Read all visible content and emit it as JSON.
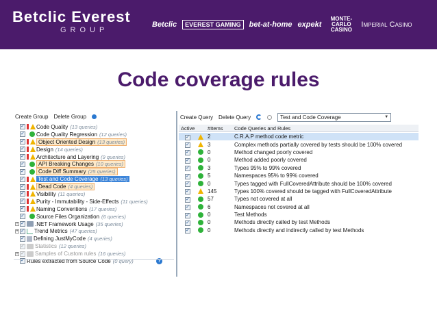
{
  "header": {
    "brand_name": "Betclic Everest",
    "brand_sub": "GROUP",
    "logos": [
      "Betclic",
      "EVEREST GAMING",
      "bet-at-home",
      "expekt",
      "MONTE-CARLO CASINO",
      "Imperial Casino"
    ]
  },
  "slide_title": "Code coverage rules",
  "left_toolbar": {
    "create_group": "Create Group",
    "delete_group": "Delete Group"
  },
  "tree": [
    {
      "label": "Code Quality",
      "count": "(13 queries)",
      "icon": "warning-icon",
      "expander": "",
      "hl": ""
    },
    {
      "label": "Code Quality Regression",
      "count": "(12 queries)",
      "icon": "ok-icon",
      "expander": "",
      "hl": ""
    },
    {
      "label": "Object Oriented Design",
      "count": "(13 queries)",
      "icon": "warning-icon",
      "expander": "",
      "hl": "orange"
    },
    {
      "label": "Design",
      "count": "(14 queries)",
      "icon": "warning-icon",
      "expander": "",
      "hl": ""
    },
    {
      "label": "Architecture and Layering",
      "count": "(9 queries)",
      "icon": "warning-icon",
      "expander": "",
      "hl": ""
    },
    {
      "label": "API Breaking Changes",
      "count": "(10 queries)",
      "icon": "ok-icon",
      "expander": "",
      "hl": "orange"
    },
    {
      "label": "Code Diff Summary",
      "count": "(25 queries)",
      "icon": "ok-icon",
      "expander": "",
      "hl": "orange"
    },
    {
      "label": "Test and Code Coverage",
      "count": "(13 queries)",
      "icon": "warning-icon",
      "expander": "",
      "hl": "blue"
    },
    {
      "label": "Dead Code",
      "count": "(4 queries)",
      "icon": "warning-icon",
      "expander": "",
      "hl": "orange"
    },
    {
      "label": "Visibility",
      "count": "(11 queries)",
      "icon": "warning-icon",
      "expander": "",
      "hl": ""
    },
    {
      "label": "Purity - Immutability - Side-Effects",
      "count": "(11 queries)",
      "icon": "warning-icon",
      "expander": "",
      "hl": ""
    },
    {
      "label": "Naming Conventions",
      "count": "(17 queries)",
      "icon": "warning-icon",
      "expander": "",
      "hl": ""
    },
    {
      "label": "Source Files Organization",
      "count": "(6 queries)",
      "icon": "ok-icon",
      "expander": "",
      "hl": ""
    },
    {
      "label": ".NET Framework Usage",
      "count": "(35 queries)",
      "icon": "folder-icon",
      "expander": "+",
      "hl": ""
    },
    {
      "label": "Trend Metrics",
      "count": "(47 queries)",
      "icon": "chart-icon",
      "expander": "+",
      "hl": ""
    },
    {
      "label": "Defining JustMyCode",
      "count": "(4 queries)",
      "icon": "lock-icon",
      "expander": "",
      "hl": ""
    },
    {
      "label": "Statistics",
      "count": "(12 queries)",
      "icon": "folder-light-icon",
      "expander": "",
      "hl": "",
      "muted": true
    },
    {
      "label": "Samples of Custom rules",
      "count": "(16 queries)",
      "icon": "folder-light-icon",
      "expander": "+",
      "hl": "",
      "muted": true
    },
    {
      "label": "Rules extracted from Source Code",
      "count": "(0 query)",
      "icon": "none",
      "expander": "",
      "hl": ""
    }
  ],
  "right_toolbar": {
    "create_query": "Create Query",
    "delete_query": "Delete Query",
    "selected_group": "Test and Code Coverage"
  },
  "grid_headers": {
    "active": "Active",
    "items": "#Items",
    "name": "Code Queries and Rules"
  },
  "rules": [
    {
      "status": "warning",
      "items": "2",
      "name": "C.R.A.P method code metric"
    },
    {
      "status": "warning",
      "items": "3",
      "name": "Complex methods partially covered by tests should be 100% covered"
    },
    {
      "status": "ok",
      "items": "0",
      "name": "Method changed poorly covered"
    },
    {
      "status": "ok",
      "items": "0",
      "name": "Method added poorly covered"
    },
    {
      "status": "ok",
      "items": "3",
      "name": "Types 95% to 99% covered"
    },
    {
      "status": "ok",
      "items": "5",
      "name": "Namespaces 95% to 99% covered"
    },
    {
      "status": "ok",
      "items": "0",
      "name": "Types tagged with FullCoveredAttribute should be 100% covered"
    },
    {
      "status": "warning",
      "items": "145",
      "name": "Types 100% covered should be tagged with FullCoveredAttribute"
    },
    {
      "status": "ok",
      "items": "57",
      "name": "Types not covered at all"
    },
    {
      "status": "ok",
      "items": "6",
      "name": "Namespaces not covered at all"
    },
    {
      "status": "ok",
      "items": "0",
      "name": "Test Methods"
    },
    {
      "status": "ok",
      "items": "0",
      "name": "Methods directly called by test Methods"
    },
    {
      "status": "ok",
      "items": "0",
      "name": "Methods directly and indirectly called by test Methods"
    }
  ],
  "colors": {
    "banner": "#4b1b6b",
    "title": "#4b1b6b",
    "selection": "#3b84d9",
    "highlight": "#fde9c9"
  }
}
